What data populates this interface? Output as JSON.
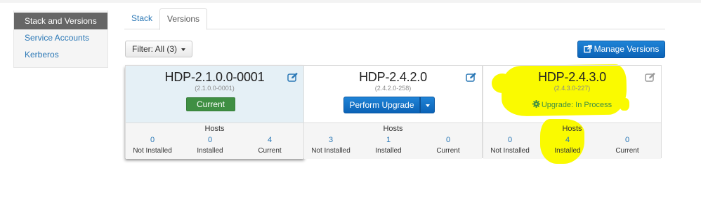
{
  "sidebar": {
    "items": [
      {
        "label": "Stack and Versions",
        "active": true
      },
      {
        "label": "Service Accounts",
        "active": false
      },
      {
        "label": "Kerberos",
        "active": false
      }
    ]
  },
  "tabs": [
    {
      "label": "Stack",
      "active": false
    },
    {
      "label": "Versions",
      "active": true
    }
  ],
  "toolbar": {
    "filter_label": "Filter: All (3)",
    "manage_label": "Manage Versions"
  },
  "cards": [
    {
      "title": "HDP-2.1.0.0-0001",
      "subtitle": "(2.1.0.0-0001)",
      "action_label": "Current",
      "hosts_label": "Hosts",
      "hosts": [
        {
          "count": "0",
          "label": "Not Installed"
        },
        {
          "count": "0",
          "label": "Installed"
        },
        {
          "count": "4",
          "label": "Current"
        }
      ]
    },
    {
      "title": "HDP-2.4.2.0",
      "subtitle": "(2.4.2.0-258)",
      "action_label": "Perform Upgrade",
      "hosts_label": "Hosts",
      "hosts": [
        {
          "count": "3",
          "label": "Not Installed"
        },
        {
          "count": "1",
          "label": "Installed"
        },
        {
          "count": "0",
          "label": "Current"
        }
      ]
    },
    {
      "title": "HDP-2.4.3.0",
      "subtitle": "(2.4.3.0-227)",
      "status_label": "Upgrade: In Process",
      "hosts_label": "Hosts",
      "hosts": [
        {
          "count": "0",
          "label": "Not Installed"
        },
        {
          "count": "4",
          "label": "Installed"
        },
        {
          "count": "0",
          "label": "Current"
        }
      ]
    }
  ],
  "colors": {
    "link": "#2b78b6",
    "primary": "#0b63b7",
    "success": "#3f8f43",
    "sidebar_active": "#666666",
    "highlight": "#fafa00"
  },
  "icons": [
    "edit-icon",
    "external-link-icon",
    "gear-icon",
    "chevron-down-icon"
  ]
}
